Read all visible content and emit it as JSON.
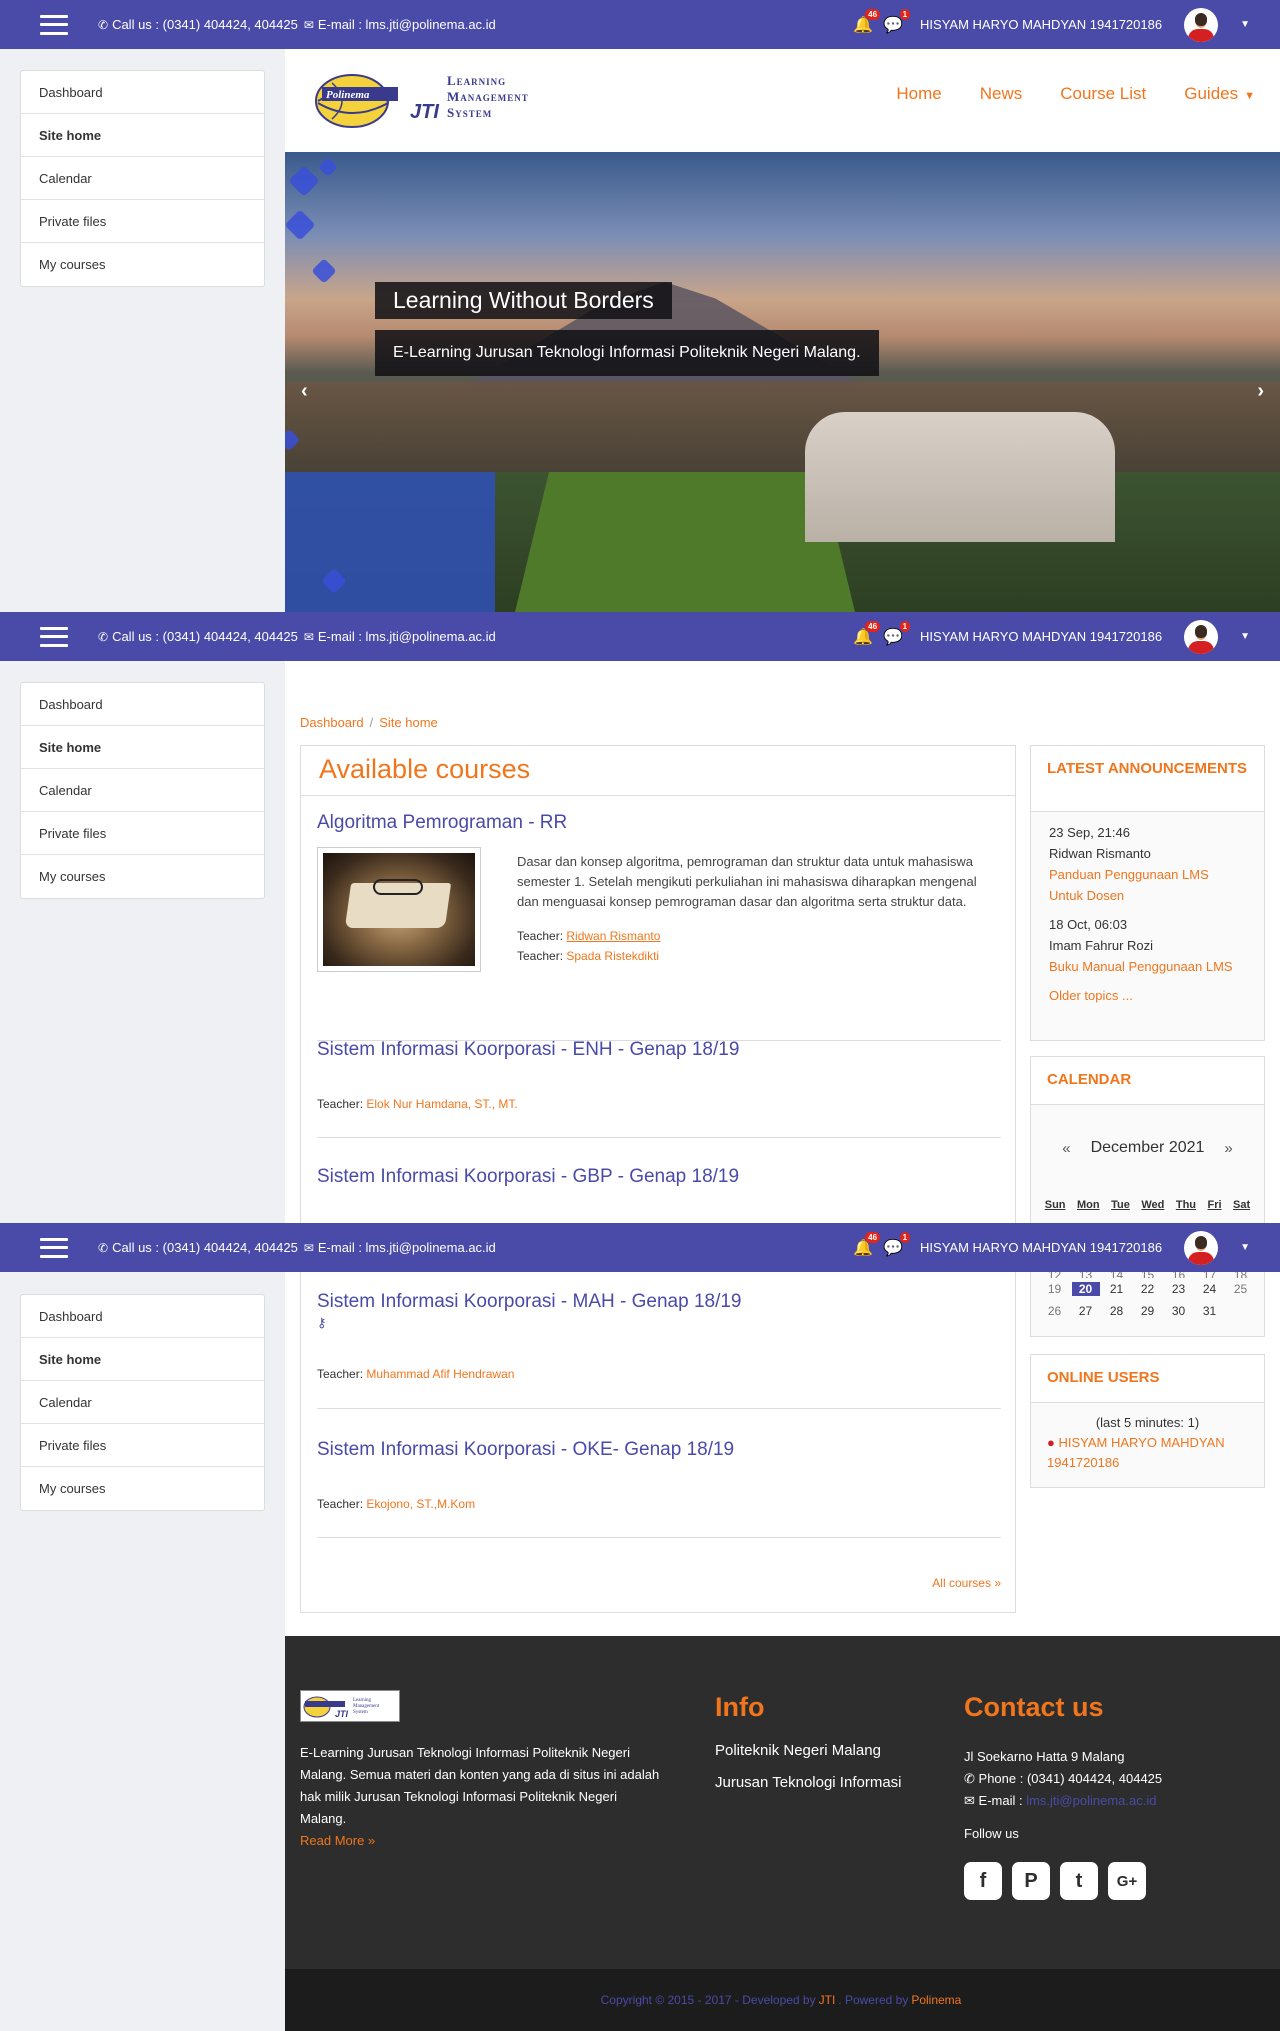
{
  "topbar": {
    "call_label": "Call us : (0341) 404424, 404425",
    "email_label": "E-mail : lms.jti@polinema.ac.id",
    "notif_count": "46",
    "message_count": "1",
    "user_name": "HISYAM HARYO MAHDYAN 1941720186"
  },
  "sidebar": {
    "items": [
      {
        "label": "Dashboard"
      },
      {
        "label": "Site home"
      },
      {
        "label": "Calendar"
      },
      {
        "label": "Private files"
      },
      {
        "label": "My courses"
      }
    ]
  },
  "brand": {
    "logo_text_line1": "Learning",
    "logo_text_line2": "Management",
    "logo_text_line3": "System",
    "logo_jti": "JTI",
    "logo_wordmark": "Polinema"
  },
  "mainnav": {
    "home": "Home",
    "news": "News",
    "course_list": "Course List",
    "guides": "Guides"
  },
  "hero": {
    "title": "Learning Without Borders",
    "subtitle": "E-Learning Jurusan Teknologi Informasi Politeknik Negeri Malang."
  },
  "breadcrumb": {
    "dashboard": "Dashboard",
    "separator": "/",
    "site_home": "Site home"
  },
  "courses": {
    "heading": "Available courses",
    "all_courses_label": "All courses »",
    "teacher_label": "Teacher:",
    "items": [
      {
        "title": "Algoritma Pemrograman - RR",
        "summary": "Dasar dan konsep algoritma, pemrograman dan struktur data untuk mahasiswa semester 1. Setelah mengikuti perkuliahan ini mahasiswa diharapkan mengenal dan menguasai konsep pemrograman dasar dan algoritma serta struktur data.",
        "teachers": [
          "Ridwan Rismanto",
          "Spada Ristekdikti"
        ]
      },
      {
        "title": "Sistem Informasi Koorporasi - ENH - Genap 18/19",
        "teachers": [
          "Elok Nur Hamdana, ST., MT."
        ]
      },
      {
        "title": "Sistem Informasi Koorporasi - GBP - Genap 18/19",
        "teachers": []
      },
      {
        "title": "Sistem Informasi Koorporasi - MAH - Genap 18/19",
        "teachers": [
          "Muhammad Afif Hendrawan"
        ]
      },
      {
        "title": "Sistem Informasi Koorporasi - OKE- Genap 18/19",
        "teachers": [
          "Ekojono, ST.,M.Kom"
        ]
      }
    ]
  },
  "announcements": {
    "heading": "LATEST ANNOUNCEMENTS",
    "items": [
      {
        "date": "23 Sep, 21:46",
        "author": "Ridwan Rismanto",
        "title": "Panduan Penggunaan LMS Untuk Dosen"
      },
      {
        "date": "18 Oct, 06:03",
        "author": "Imam Fahrur Rozi",
        "title": "Buku Manual Penggunaan LMS"
      }
    ],
    "older": "Older topics ..."
  },
  "calendar": {
    "heading": "CALENDAR",
    "month": "December 2021",
    "prev": "«",
    "next": "»",
    "weekdays": [
      "Sun",
      "Mon",
      "Tue",
      "Wed",
      "Thu",
      "Fri",
      "Sat"
    ],
    "row_partial": [
      "12",
      "13",
      "14",
      "15",
      "16",
      "17",
      "18"
    ],
    "row_today": [
      "19",
      "20",
      "21",
      "22",
      "23",
      "24",
      "25"
    ],
    "row_last": [
      "26",
      "27",
      "28",
      "29",
      "30",
      "31",
      ""
    ]
  },
  "online_users": {
    "heading": "ONLINE USERS",
    "count_label": "(last 5 minutes: 1)",
    "user": "HISYAM HARYO MAHDYAN 1941720186"
  },
  "footer": {
    "description": "E-Learning Jurusan Teknologi Informasi Politeknik Negeri Malang. Semua materi dan konten yang ada di situs ini adalah hak milik Jurusan Teknologi Informasi Politeknik Negeri Malang.",
    "read_more": "Read More »",
    "info_heading": "Info",
    "info_items": [
      "Politeknik Negeri Malang",
      "Jurusan Teknologi Informasi"
    ],
    "contact_heading": "Contact us",
    "address": "Jl Soekarno Hatta 9 Malang",
    "phone": "Phone : (0341) 404424, 404425",
    "email_prefix": "E-mail :",
    "email": "lms.jti@polinema.ac.id",
    "follow": "Follow us",
    "socials": [
      "facebook-icon",
      "pinterest-icon",
      "twitter-icon",
      "google-plus-icon"
    ]
  },
  "copyright": {
    "prefix": "Copyright © 2015 - 2017 - Developed by",
    "jti": "JTI",
    "powered": ". Powered by",
    "polinema": "Polinema"
  }
}
